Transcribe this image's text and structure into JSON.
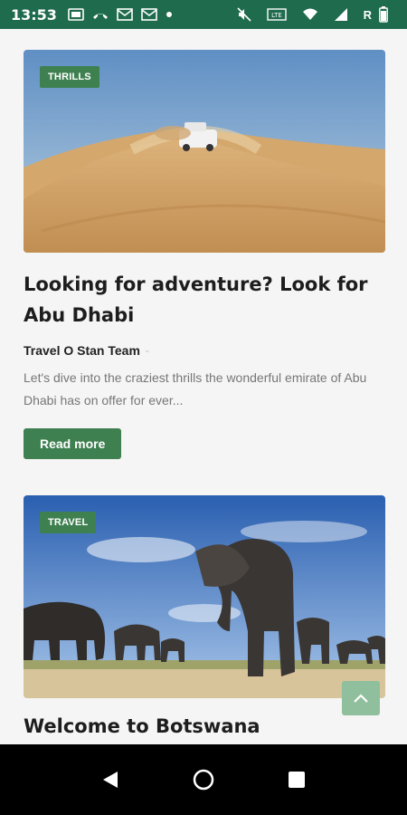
{
  "status_bar": {
    "time": "13:53",
    "carrier_letter": "R",
    "icons": [
      "gallery-icon",
      "missed-call-icon",
      "mail-icon",
      "mail-icon",
      "dot-icon",
      "mute-icon",
      "lte-icon",
      "wifi-icon",
      "signal-icon",
      "battery-icon"
    ]
  },
  "posts": [
    {
      "category": "THRILLS",
      "title": "Looking for adventure? Look for Abu Dhabi",
      "author": "Travel O Stan Team",
      "separator": "-",
      "excerpt": "Let's dive into the craziest thrills the wonderful emirate of Abu Dhabi has on offer for ever...",
      "cta": "Read more"
    },
    {
      "category": "TRAVEL",
      "title": "Welcome to Botswana"
    }
  ],
  "colors": {
    "status_bar": "#1f6b4d",
    "accent": "#3f8050",
    "scroll_top": "#8fbf9d"
  },
  "nav_bar": {
    "icons": [
      "back-icon",
      "home-icon",
      "recents-icon"
    ]
  }
}
